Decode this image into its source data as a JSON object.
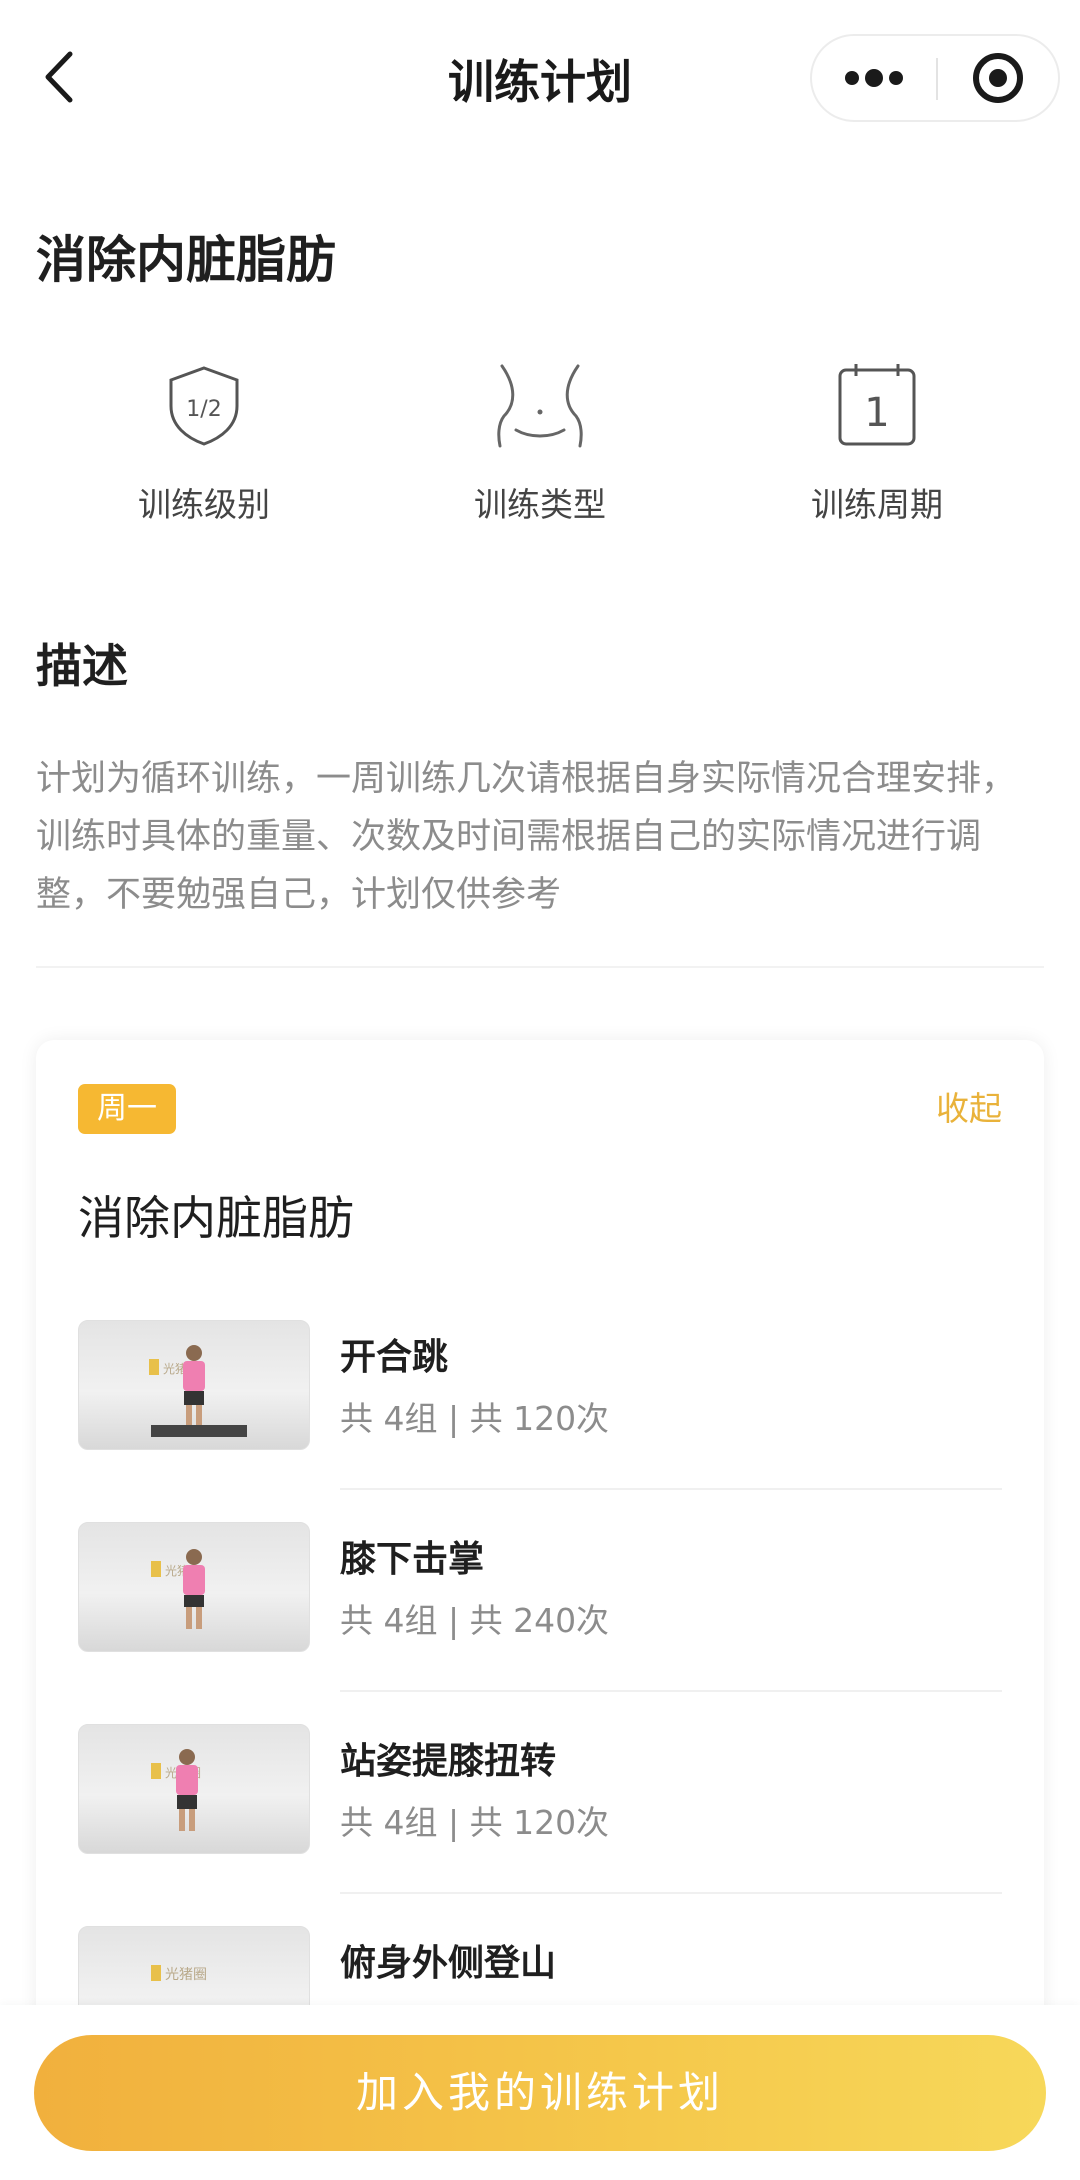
{
  "nav": {
    "title": "训练计划",
    "back_icon": "chevron-left-icon",
    "more_icon": "more-dots-icon",
    "close_icon": "target-circle-icon"
  },
  "plan": {
    "title": "消除内脏脂肪",
    "attributes": [
      {
        "icon": "shield-level-icon",
        "icon_text": "1/2",
        "label": "训练级别"
      },
      {
        "icon": "waist-icon",
        "label": "训练类型"
      },
      {
        "icon": "calendar-icon",
        "icon_text": "1",
        "label": "训练周期"
      }
    ]
  },
  "description": {
    "heading": "描述",
    "text": "计划为循环训练，一周训练几次请根据自身实际情况合理安排，训练时具体的重量、次数及时间需根据自己的实际情况进行调整，不要勉强自己，计划仅供参考"
  },
  "day": {
    "badge": "周一",
    "collapse_label": "收起",
    "title": "消除内脏脂肪",
    "exercises": [
      {
        "name": "开合跳",
        "meta": "共 4组 | 共 120次",
        "logo_text": "光猪圈"
      },
      {
        "name": "膝下击掌",
        "meta": "共 4组 | 共 240次",
        "logo_text": "光猪圈"
      },
      {
        "name": "站姿提膝扭转",
        "meta": "共 4组 | 共 120次",
        "logo_text": "光猪圈"
      },
      {
        "name": "俯身外侧登山",
        "meta": "",
        "logo_text": "光猪圈"
      }
    ]
  },
  "footer": {
    "join_label": "加入我的训练计划"
  },
  "colors": {
    "accent": "#f6b832",
    "button_start": "#f1b03d",
    "button_end": "#f7d85a",
    "muted_text": "#8c8c8c"
  }
}
